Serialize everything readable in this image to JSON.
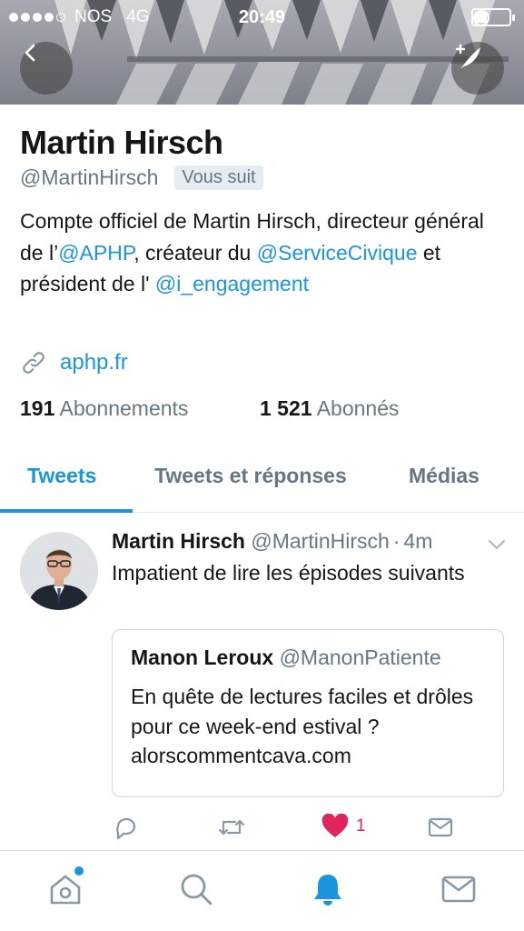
{
  "status_bar": {
    "carrier": "NOS",
    "network": "4G",
    "time": "20:49",
    "signal_bars_filled": 4,
    "signal_bars_total": 5,
    "battery_level": 0.35
  },
  "header": {
    "back_icon": "chevron-left-icon",
    "compose_icon": "compose-tweet-icon"
  },
  "profile": {
    "name": "Martin Hirsch",
    "handle": "@MartinHirsch",
    "follows_you": "Vous suit",
    "bio": {
      "part1": "Compte officiel de Martin Hirsch, directeur général de l’",
      "mention1": "@APHP",
      "part2": ", créateur du ",
      "mention2": "@ServiceCivique",
      "part3": " et président de l' ",
      "mention3": "@i_engagement"
    },
    "website": "aphp.fr",
    "following_count": "191",
    "following_label": "Abonnements",
    "followers_count": "1 521",
    "followers_label": "Abonnés"
  },
  "tabs": [
    {
      "label": "Tweets",
      "active": true
    },
    {
      "label": "Tweets et réponses",
      "active": false
    },
    {
      "label": "Médias",
      "active": false
    }
  ],
  "tweet": {
    "author": "Martin Hirsch",
    "handle": "@MartinHirsch",
    "separator": "·",
    "time": "4m",
    "text": "Impatient de lire les épisodes suivants",
    "quote": {
      "author": "Manon Leroux",
      "handle": "@ManonPatiente",
      "text": "En quête de lectures faciles et drôles pour ce week-end estival ? alorscommentcava.com"
    },
    "likes": "1"
  },
  "colors": {
    "accent": "#1b95e0",
    "like": "#e0245e",
    "secondary_text": "#657786"
  }
}
